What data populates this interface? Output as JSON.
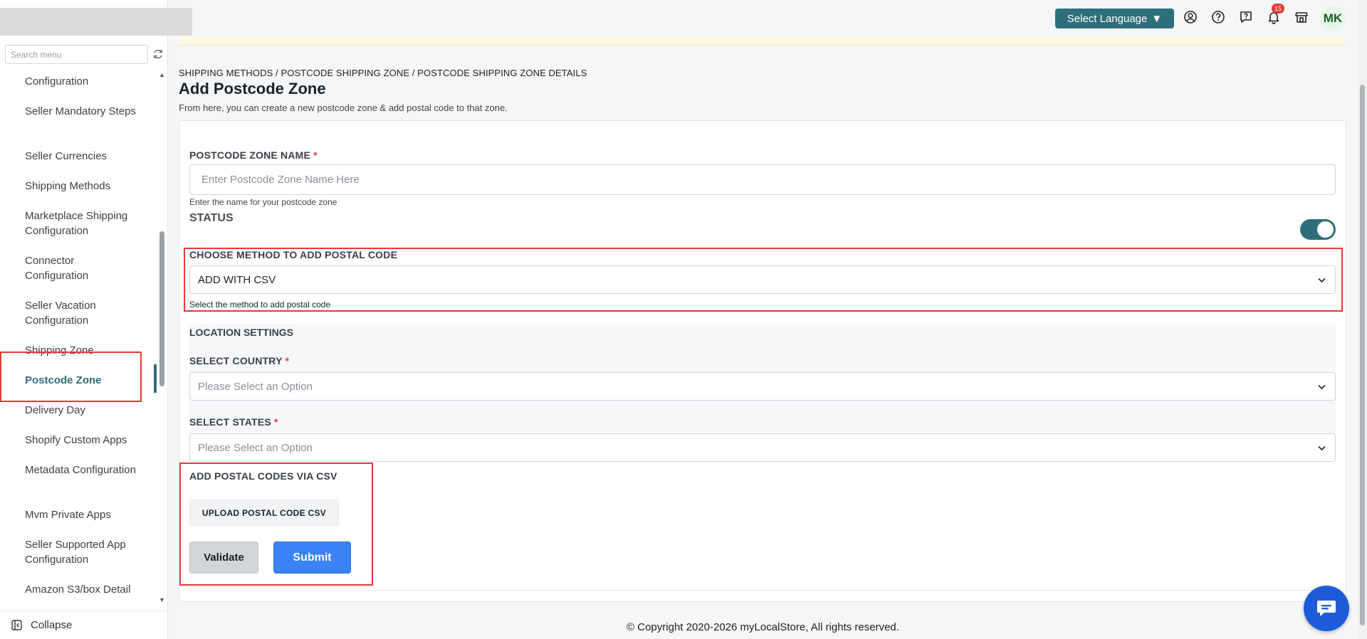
{
  "sidebar": {
    "search_placeholder": "Search menu",
    "items": [
      {
        "label": "Configuration"
      },
      {
        "label": "Seller Mandatory Steps"
      },
      {
        "label": "Seller Currencies"
      },
      {
        "label": "Shipping Methods"
      },
      {
        "label": "Marketplace Shipping Configuration"
      },
      {
        "label": "Connector Configuration"
      },
      {
        "label": "Seller Vacation Configuration"
      },
      {
        "label": "Shipping Zone"
      },
      {
        "label": "Postcode Zone"
      },
      {
        "label": "Delivery Day"
      },
      {
        "label": "Shopify Custom Apps"
      },
      {
        "label": "Metadata Configuration"
      },
      {
        "label": "Mvm Private Apps"
      },
      {
        "label": "Seller Supported App Configuration"
      },
      {
        "label": "Amazon S3/box Detail"
      }
    ],
    "active_item": "Postcode Zone",
    "collapse_label": "Collapse"
  },
  "topbar": {
    "language_label": "Select Language",
    "notification_count": "15",
    "avatar_initials": "MK"
  },
  "header": {
    "breadcrumb": "SHIPPING METHODS / POSTCODE SHIPPING ZONE / POSTCODE SHIPPING ZONE DETAILS",
    "title": "Add Postcode Zone",
    "description": "From here, you can create a new postcode zone & add postal code to that zone."
  },
  "form": {
    "zone_name_label": "POSTCODE ZONE NAME",
    "zone_name_placeholder": "Enter Postcode Zone Name Here",
    "zone_name_value": "",
    "zone_name_hint": "Enter the name for your postcode zone",
    "status_label": "STATUS",
    "status_on": true,
    "method_label": "CHOOSE METHOD TO ADD POSTAL CODE",
    "method_value": "ADD WITH CSV",
    "method_hint": "Select the method to add postal code",
    "location_title": "LOCATION SETTINGS",
    "country_label": "SELECT COUNTRY",
    "country_placeholder": "Please Select an Option",
    "states_label": "SELECT STATES",
    "states_placeholder": "Please Select an Option",
    "csv_title": "ADD POSTAL CODES VIA CSV",
    "upload_label": "UPLOAD POSTAL CODE CSV",
    "validate_label": "Validate",
    "submit_label": "Submit",
    "required_mark": "*"
  },
  "footer": {
    "copyright": "© Copyright 2020-2026 myLocalStore, All rights reserved."
  },
  "colors": {
    "accent": "#2f6e7b",
    "primary": "#3b82f6",
    "highlight": "#e53935"
  }
}
